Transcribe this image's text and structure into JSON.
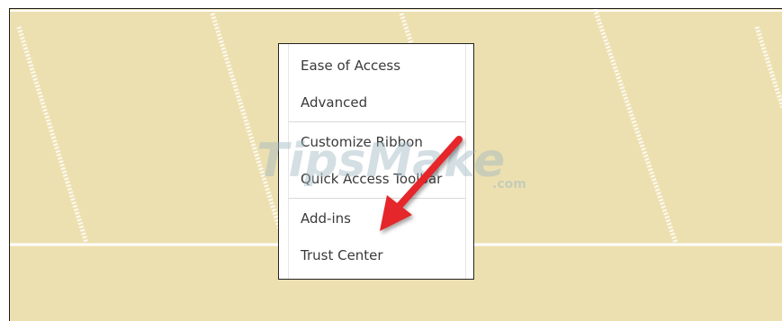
{
  "menu": {
    "items": [
      {
        "label": "Ease of Access"
      },
      {
        "label": "Advanced"
      },
      {
        "label": "Customize Ribbon"
      },
      {
        "label": "Quick Access Toolbar"
      },
      {
        "label": "Add-ins"
      },
      {
        "label": "Trust Center"
      }
    ]
  },
  "watermark": {
    "brand": "TipsMake",
    "suffix": ".com"
  },
  "colors": {
    "canvas": "#ede0b0",
    "arrow": "#e5262a",
    "menu_text": "#3a3a3a"
  },
  "icons": {
    "pointer": "red-arrow-icon"
  }
}
